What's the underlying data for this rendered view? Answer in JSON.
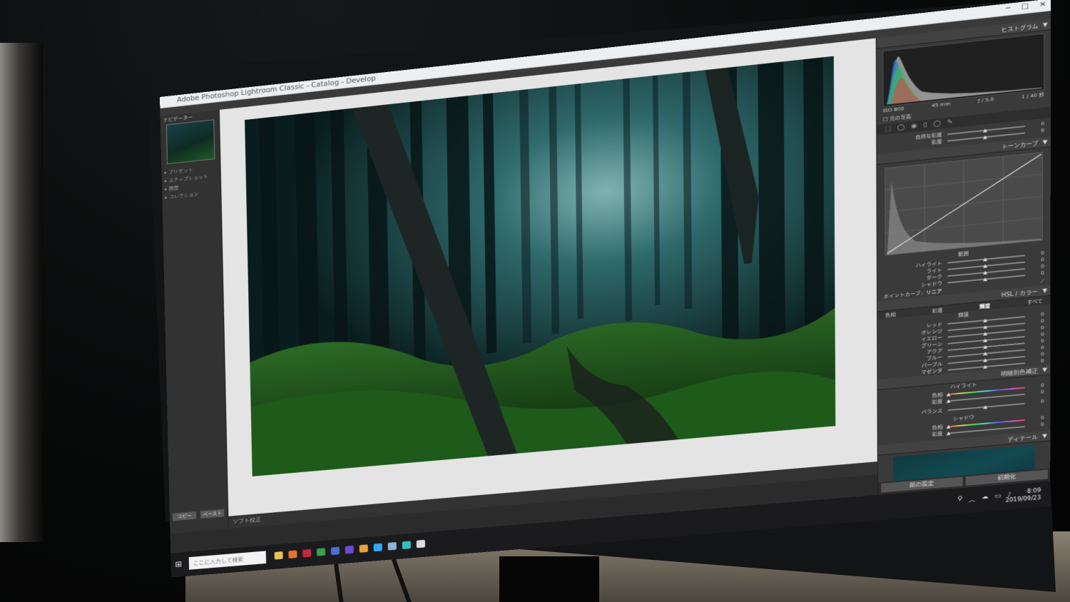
{
  "window": {
    "title": "Adobe Photoshop Lightroom Classic - Catalog - Develop",
    "controls": [
      "─",
      "□",
      "✕"
    ]
  },
  "left_panel": {
    "header": "ナビゲーター",
    "items": [
      "▸ プリセット",
      "▸ スナップショット",
      "▸ 履歴",
      "▸ コレクション"
    ],
    "buttons": [
      "コピー",
      "ペースト"
    ]
  },
  "statusbar": {
    "text": "ソフト校正"
  },
  "histogram": {
    "title": "ヒストグラム",
    "iso": "ISO 800",
    "focal": "45 mm",
    "aperture": "ƒ / 5.0",
    "shutter": "1 / 40 秒",
    "original_photo": "元の写真"
  },
  "presence": {
    "rows": [
      {
        "label": "自然な彩度",
        "value": "0",
        "level": 0.5
      },
      {
        "label": "彩度",
        "value": "0",
        "level": 0.5
      }
    ]
  },
  "tone_curve": {
    "title": "トーンカーブ",
    "region_label": "範囲",
    "rows": [
      {
        "label": "ハイライト",
        "value": "0",
        "level": 0.5
      },
      {
        "label": "ライト",
        "value": "0",
        "level": 0.5
      },
      {
        "label": "ダーク",
        "value": "0",
        "level": 0.5
      },
      {
        "label": "シャドウ",
        "value": "0",
        "level": 0.5
      }
    ],
    "point_curve_label": "ポイントカーブ：",
    "point_curve_value": "リニア"
  },
  "hsl": {
    "title": "HSL / カラー",
    "tabs": [
      "色相",
      "彩度",
      "輝度",
      "すべて"
    ],
    "active_tab": "輝度",
    "section_label": "輝度",
    "rows": [
      {
        "label": "レッド",
        "value": "0",
        "level": 0.5
      },
      {
        "label": "オレンジ",
        "value": "0",
        "level": 0.5
      },
      {
        "label": "イエロー",
        "value": "0",
        "level": 0.5
      },
      {
        "label": "グリーン",
        "value": "0",
        "level": 0.5
      },
      {
        "label": "アクア",
        "value": "0",
        "level": 0.5
      },
      {
        "label": "ブルー",
        "value": "0",
        "level": 0.5
      },
      {
        "label": "パープル",
        "value": "0",
        "level": 0.5
      },
      {
        "label": "マゼンタ",
        "value": "0",
        "level": 0.5
      }
    ]
  },
  "split_toning": {
    "title": "明暗別色補正",
    "highlight_label": "ハイライト",
    "highlight_rows": [
      {
        "label": "色相",
        "value": "0",
        "level": 0.0
      },
      {
        "label": "彩度",
        "value": "0",
        "level": 0.0
      }
    ],
    "balance_label": "バランス",
    "balance_value": "0",
    "shadow_label": "シャドウ",
    "shadow_rows": [
      {
        "label": "色相",
        "value": "0",
        "level": 0.0
      },
      {
        "label": "彩度",
        "value": "0",
        "level": 0.0
      }
    ]
  },
  "detail": {
    "title": "ディテール"
  },
  "bottom_buttons": {
    "previous": "前の設定",
    "reset": "初期化"
  },
  "taskbar": {
    "search_placeholder": "ここに入力して検索",
    "app_colors": [
      "#e8c15a",
      "#e7742c",
      "#c3293b",
      "#3a9d4a",
      "#4b6fd6",
      "#6b4bd6",
      "#e6a23c",
      "#31a8ff",
      "#8cb4d6",
      "#30c0c0",
      "#dddddd"
    ],
    "time": "8:09",
    "date": "2019/09/23"
  }
}
